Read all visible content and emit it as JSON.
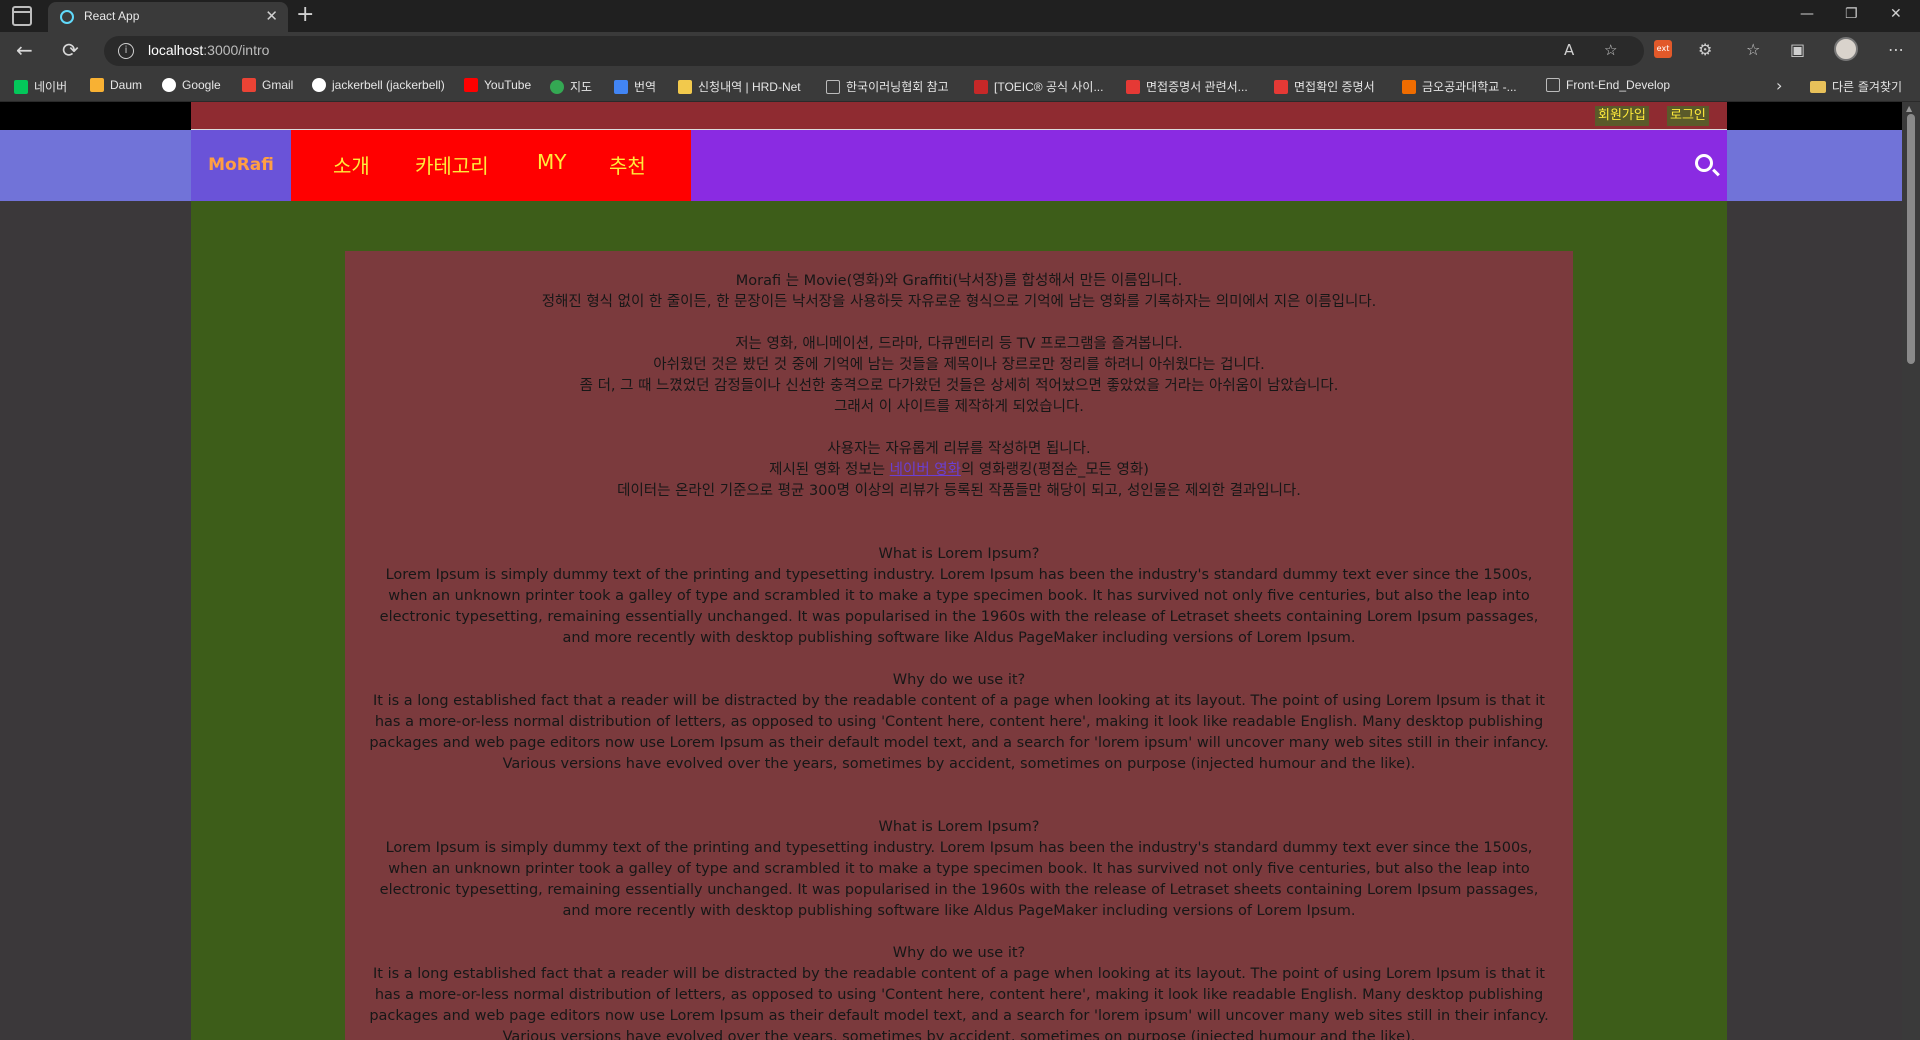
{
  "browser": {
    "tab_title": "React App",
    "url_host": "localhost",
    "url_path": ":3000/intro",
    "bookmarks": [
      {
        "label": "네이버",
        "color": "#03c75a"
      },
      {
        "label": "Daum",
        "color": "#f8b133"
      },
      {
        "label": "Google",
        "color": "#ffffff"
      },
      {
        "label": "Gmail",
        "color": "#ea4335"
      },
      {
        "label": "jackerbell (jackerbell)",
        "color": "#ffffff"
      },
      {
        "label": "YouTube",
        "color": "#ff0000"
      },
      {
        "label": "지도",
        "color": "#34a853"
      },
      {
        "label": "번역",
        "color": "#4285f4"
      },
      {
        "label": "신청내역 | HRD-Net",
        "color": "#f2c94c"
      },
      {
        "label": "한국이러닝협회 참고",
        "color": "#bbbbbb"
      },
      {
        "label": "[TOEIC® 공식 사이...",
        "color": "#c62828"
      },
      {
        "label": "면접증명서 관련서...",
        "color": "#e53935"
      },
      {
        "label": "면접확인 증명서",
        "color": "#e53935"
      },
      {
        "label": "금오공과대학교 -...",
        "color": "#ef6c00"
      },
      {
        "label": "Front-End_Develop",
        "color": "#bbbbbb"
      }
    ],
    "other_favorites": "다른 즐겨찾기"
  },
  "site": {
    "signup": "회원가입",
    "login": "로그인",
    "logo": "MoRafi",
    "nav": [
      "소개",
      "카테고리",
      "MY",
      "추천"
    ]
  },
  "intro": {
    "p1_l1": "Morafi 는 Movie(영화)와 Graffiti(낙서장)를 합성해서 만든 이름입니다.",
    "p1_l2": "정해진 형식 없이 한 줄이든, 한 문장이든 낙서장을 사용하듯 자유로운 형식으로 기억에 남는 영화를 기록하자는 의미에서 지은 이름입니다.",
    "p2_l1": "저는 영화, 애니메이션, 드라마, 다큐멘터리 등 TV 프로그램을 즐겨봅니다.",
    "p2_l2": "아쉬웠던 것은 봤던 것 중에 기억에 남는 것들을 제목이나 장르로만 정리를 하려니 아쉬웠다는 겁니다.",
    "p2_l3": "좀 더, 그 때 느꼈었던 감정들이나 신선한 충격으로 다가왔던 것들은 상세히 적어놨으면 좋았었을 거라는 아쉬움이 남았습니다.",
    "p2_l4": "그래서 이 사이트를 제작하게 되었습니다.",
    "p3_l1": "사용자는 자유롭게 리뷰를 작성하면 됩니다.",
    "p3_l2_prefix": "제시된 영화 정보는 ",
    "p3_l2_link": "네이버 영화",
    "p3_l2_suffix": "의 영화랭킹(평점순_모든 영화)",
    "p3_l3": "데이터는 온라인 기준으로 평균 300명 이상의 리뷰가 등록된 작품들만 해당이 되고, 성인물은 제외한 결과입니다.",
    "lorem_q1": "What is Lorem Ipsum?",
    "lorem_a1": "Lorem Ipsum is simply dummy text of the printing and typesetting industry. Lorem Ipsum has been the industry's standard dummy text ever since the 1500s, when an unknown printer took a galley of type and scrambled it to make a type specimen book. It has survived not only five centuries, but also the leap into electronic typesetting, remaining essentially unchanged. It was popularised in the 1960s with the release of Letraset sheets containing Lorem Ipsum passages, and more recently with desktop publishing software like Aldus PageMaker including versions of Lorem Ipsum.",
    "lorem_q2": "Why do we use it?",
    "lorem_a2": "It is a long established fact that a reader will be distracted by the readable content of a page when looking at its layout. The point of using Lorem Ipsum is that it has a more-or-less normal distribution of letters, as opposed to using 'Content here, content here', making it look like readable English. Many desktop publishing packages and web page editors now use Lorem Ipsum as their default model text, and a search for 'lorem ipsum' will uncover many web sites still in their infancy. Various versions have evolved over the years, sometimes by accident, sometimes on purpose (injected humour and the like)."
  }
}
